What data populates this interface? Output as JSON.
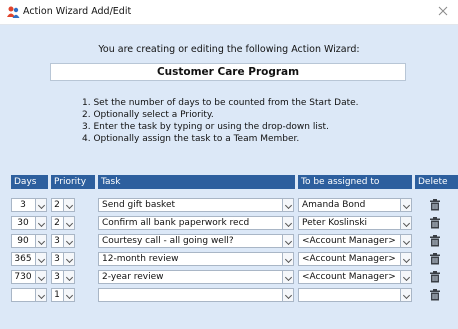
{
  "window": {
    "title": "Action Wizard Add/Edit"
  },
  "intro": "You are creating or editing the following Action Wizard:",
  "wizard_name": "Customer Care Program",
  "instructions": [
    "1. Set the number of days to be counted from the Start Date.",
    "2. Optionally select a Priority.",
    "3. Enter the task by typing or using the drop-down list.",
    "4. Optionally assign the task to a Team Member."
  ],
  "columns": {
    "days": "Days",
    "priority": "Priority",
    "task": "Task",
    "assigned": "To be assigned to",
    "delete": "Delete"
  },
  "rows": [
    {
      "days": "3",
      "priority": "2",
      "task": "Send gift basket",
      "assigned": "Amanda Bond"
    },
    {
      "days": "30",
      "priority": "2",
      "task": "Confirm all bank paperwork recd",
      "assigned": "Peter Koslinski"
    },
    {
      "days": "90",
      "priority": "3",
      "task": "Courtesy call - all going well?",
      "assigned": "<Account Manager>"
    },
    {
      "days": "365",
      "priority": "3",
      "task": "12-month review",
      "assigned": "<Account Manager>"
    },
    {
      "days": "730",
      "priority": "3",
      "task": "2-year review",
      "assigned": "<Account Manager>"
    },
    {
      "days": "",
      "priority": "1",
      "task": "",
      "assigned": ""
    }
  ],
  "colors": {
    "header_bg": "#2d5f9e",
    "window_bg": "#dce8f7",
    "field_border": "#a9b6c6"
  },
  "icons": {
    "app": "people-icon",
    "close": "close-icon",
    "delete": "trash-icon",
    "dropdown": "chevron-down-icon"
  }
}
